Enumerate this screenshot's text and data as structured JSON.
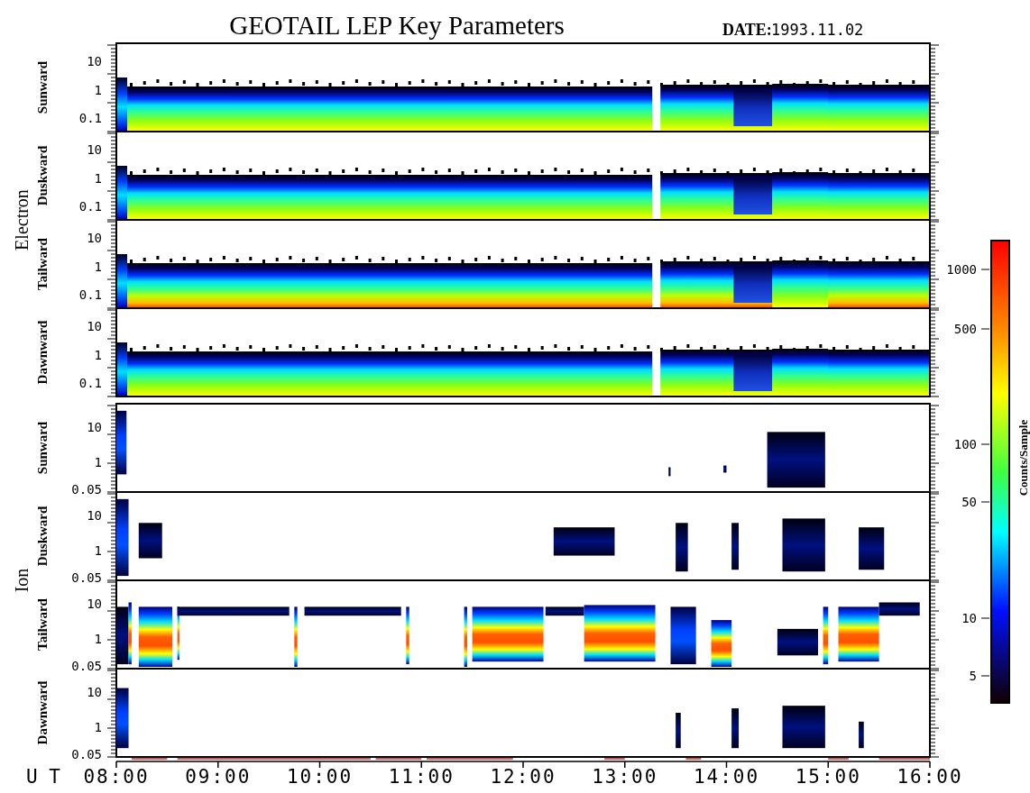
{
  "title": "GEOTAIL LEP Key Parameters",
  "date_label": "DATE:",
  "date": "1993.11.02",
  "groups": [
    {
      "name": "Electron",
      "kind": "electron",
      "panels": [
        {
          "direction": "Sunward",
          "yticks": [
            "10",
            "1",
            "0.1"
          ]
        },
        {
          "direction": "Duskward",
          "yticks": [
            "10",
            "1",
            "0.1"
          ]
        },
        {
          "direction": "Tailward",
          "yticks": [
            "10",
            "1",
            "0.1"
          ]
        },
        {
          "direction": "Dawnward",
          "yticks": [
            "10",
            "1",
            "0.1"
          ]
        }
      ]
    },
    {
      "name": "Ion",
      "kind": "ion",
      "panels": [
        {
          "direction": "Sunward",
          "yticks": [
            "10",
            "1",
            "0.05"
          ]
        },
        {
          "direction": "Duskward",
          "yticks": [
            "10",
            "1",
            "0.05"
          ]
        },
        {
          "direction": "Tailward",
          "yticks": [
            "10",
            "1",
            "0.05"
          ]
        },
        {
          "direction": "Dawnward",
          "yticks": [
            "10",
            "1",
            "0.05"
          ]
        }
      ]
    }
  ],
  "x_axis": {
    "label": "U T",
    "ticks": [
      "08:00",
      "09:00",
      "10:00",
      "11:00",
      "12:00",
      "13:00",
      "14:00",
      "15:00",
      "16:00"
    ]
  },
  "colorbar": {
    "label": "Counts/Sample",
    "ticks": [
      "1000",
      "500",
      "100",
      "50",
      "10",
      "5"
    ]
  }
}
